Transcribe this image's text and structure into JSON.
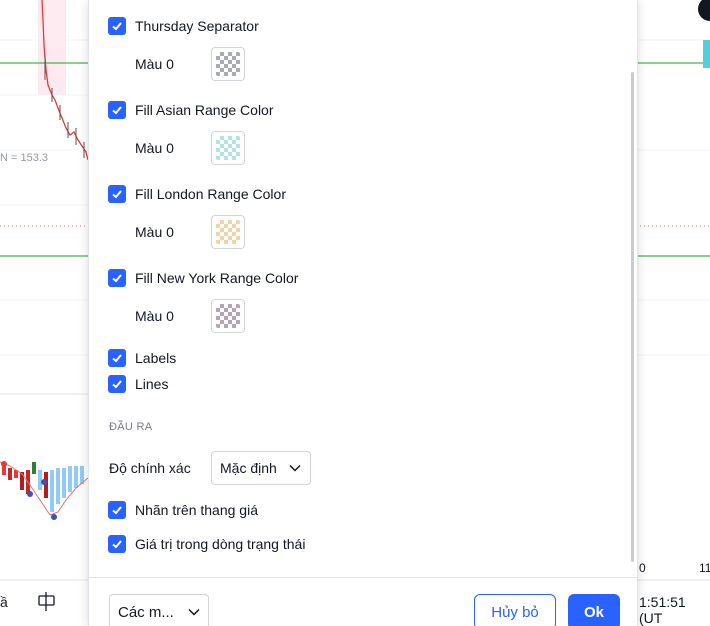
{
  "background": {
    "left_label": "N = 153.3",
    "bottom_left_text": "ầ",
    "bottom_right_time": "1:51:51 (UT",
    "right_axis_mark_1": "0",
    "right_axis_mark_2": "11",
    "colors": {
      "green_line": "#4caf50",
      "candle_red": "#e53935",
      "histogram_blue": "#90caf9"
    }
  },
  "dialog": {
    "rows": [
      {
        "label": "Thursday Separator",
        "checked": true
      },
      {
        "label": "Fill Asian Range Color",
        "checked": true
      },
      {
        "label": "Fill London Range Color",
        "checked": true
      },
      {
        "label": "Fill New York Range Color",
        "checked": true
      },
      {
        "label": "Labels",
        "checked": true
      },
      {
        "label": "Lines",
        "checked": true
      },
      {
        "label": "Nhãn trên thang giá",
        "checked": true
      },
      {
        "label": "Giá trị trong dòng trạng thái",
        "checked": true
      }
    ],
    "color_rows": [
      {
        "label": "Màu 0",
        "swatch_color": "#a9aab8"
      },
      {
        "label": "Màu 0",
        "swatch_color": "#b2e1e6"
      },
      {
        "label": "Màu 0",
        "swatch_color": "#f3d4a8"
      },
      {
        "label": "Màu 0",
        "swatch_color": "#b8a3b3"
      }
    ],
    "output_section_title": "ĐẦU RA",
    "precision": {
      "label": "Độ chính xác",
      "value": "Mặc định"
    },
    "footer": {
      "template_value": "Các m...",
      "cancel_label": "Hủy bỏ",
      "ok_label": "Ok"
    },
    "accent_color": "#2962ff"
  }
}
